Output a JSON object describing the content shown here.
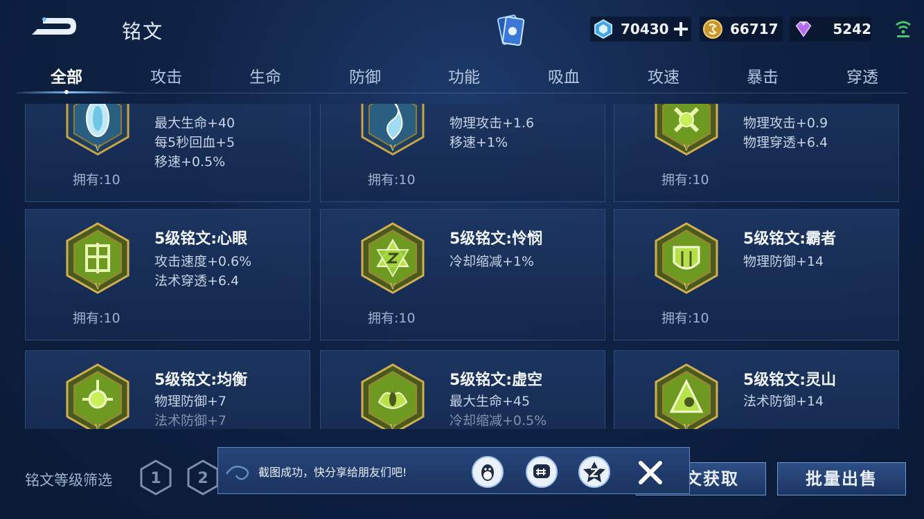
{
  "header": {
    "title": "铭文",
    "currencies": [
      {
        "icon": "crystal-icon",
        "value": "70430"
      },
      {
        "icon": "gold-coin-icon",
        "value": "66717"
      },
      {
        "icon": "gem-icon",
        "value": "5242"
      }
    ]
  },
  "tabs": [
    {
      "label": "全部",
      "active": true
    },
    {
      "label": "攻击"
    },
    {
      "label": "生命"
    },
    {
      "label": "防御"
    },
    {
      "label": "功能"
    },
    {
      "label": "吸血"
    },
    {
      "label": "攻速"
    },
    {
      "label": "暴击"
    },
    {
      "label": "穿透"
    }
  ],
  "runes": [
    {
      "name": "",
      "attrs": [
        "最大生命+40",
        "每5秒回血+5",
        "移速+0.5%"
      ],
      "owned": "拥有:10",
      "color": "blue",
      "level": "V"
    },
    {
      "name": "",
      "attrs": [
        "物理攻击+1.6",
        "移速+1%"
      ],
      "owned": "拥有:10",
      "color": "blue",
      "level": "V"
    },
    {
      "name": "",
      "attrs": [
        "物理攻击+0.9",
        "物理穿透+6.4"
      ],
      "owned": "拥有:10",
      "color": "green",
      "level": "V"
    },
    {
      "name": "5级铭文:心眼",
      "attrs": [
        "攻击速度+0.6%",
        "法术穿透+6.4"
      ],
      "owned": "拥有:10",
      "color": "green",
      "level": "V"
    },
    {
      "name": "5级铭文:怜悯",
      "attrs": [
        "冷却缩减+1%"
      ],
      "owned": "拥有:10",
      "color": "green",
      "level": "V"
    },
    {
      "name": "5级铭文:霸者",
      "attrs": [
        "物理防御+14"
      ],
      "owned": "拥有:10",
      "color": "green",
      "level": "V"
    },
    {
      "name": "5级铭文:均衡",
      "attrs": [
        "物理防御+7",
        "法术防御+7"
      ],
      "owned": "",
      "color": "green",
      "level": "V"
    },
    {
      "name": "5级铭文:虚空",
      "attrs": [
        "最大生命+45",
        "冷却缩减+0.5%"
      ],
      "owned": "",
      "color": "green",
      "level": "V"
    },
    {
      "name": "5级铭文:灵山",
      "attrs": [
        "法术防御+14"
      ],
      "owned": "",
      "color": "green",
      "level": "V"
    }
  ],
  "footer": {
    "filter_label": "铭文等级筛选",
    "levels": [
      "1",
      "2"
    ],
    "get_button": "文获取",
    "sell_button": "批量出售"
  },
  "toast": {
    "message": "截图成功，快分享给朋友们吧!",
    "share_targets": [
      "qq-icon",
      "wechat-icon",
      "qzone-icon"
    ]
  }
}
